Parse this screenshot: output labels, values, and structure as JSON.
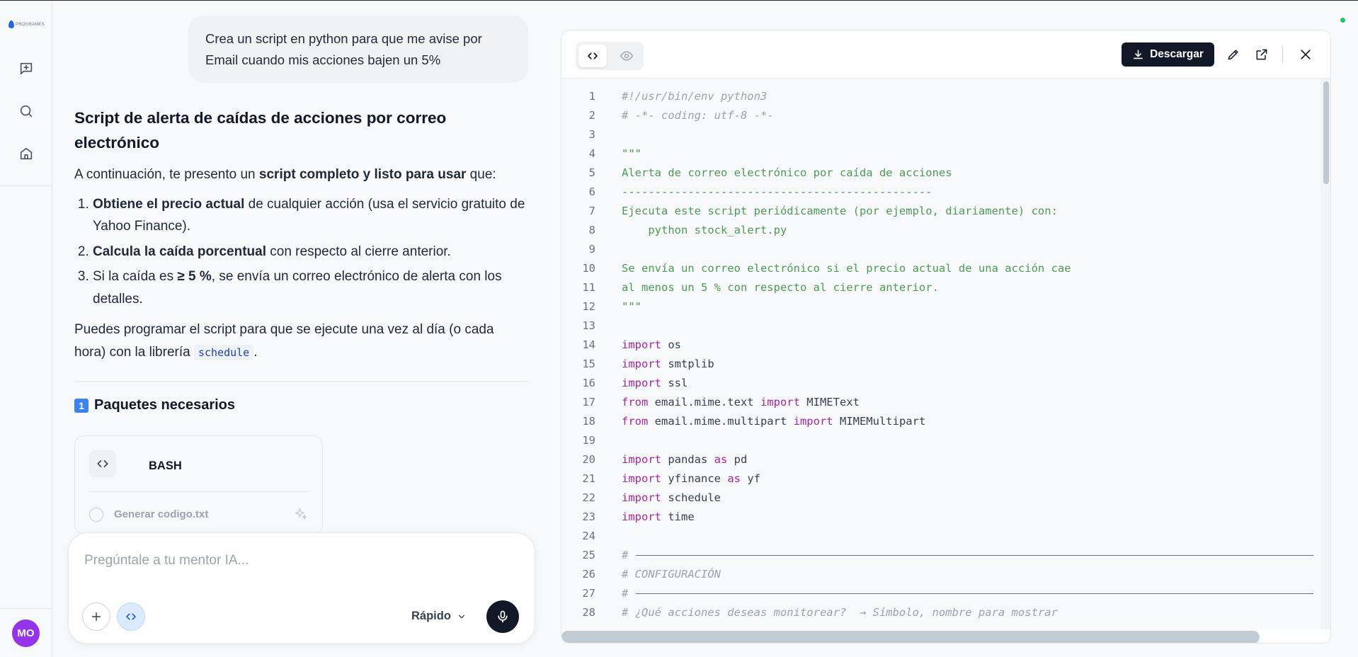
{
  "sidebar": {
    "logo_text": "PROGRAMES",
    "items": [
      {
        "name": "new-chat",
        "icon": "new-chat-icon"
      },
      {
        "name": "search",
        "icon": "search-icon"
      },
      {
        "name": "home",
        "icon": "home-icon"
      }
    ],
    "avatar": "MO"
  },
  "chat": {
    "user_message": "Crea un script en python para que me avise por Email cuando mis acciones bajen un 5%",
    "answer": {
      "title": "Script de alerta de caídas de acciones por correo electrónico",
      "intro_pre": "A continuación, te presento un ",
      "intro_bold": "script completo y listo para usar",
      "intro_post": " que:",
      "list": [
        {
          "bold": "Obtiene el precio actual",
          "text": " de cualquier acción (usa el servicio gratuito de Yahoo Finance)."
        },
        {
          "bold": "Calcula la caída porcentual",
          "text": " con respecto al cierre anterior."
        },
        {
          "pre": "Si la caída es ",
          "bold": "≥ 5 %",
          "text": ", se envía un correo electrónico de alerta con los detalles."
        }
      ],
      "p2_pre": "Puedes programar el script para que se ejecute una vez al día (o cada hora) con la librería ",
      "p2_code": "schedule",
      "p2_post": ".",
      "section_num": "1",
      "section_title": "Paquetes necesarios"
    },
    "code_card": {
      "lang": "BASH",
      "filename": "Generar codigo.txt"
    },
    "composer": {
      "placeholder": "Pregúntale a tu mentor IA...",
      "mode": "Rápido"
    }
  },
  "panel": {
    "download_label": "Descargar",
    "code_lines": [
      {
        "n": "1",
        "t": "#!/usr/bin/env python3",
        "c": "comment"
      },
      {
        "n": "2",
        "t": "# -*- coding: utf-8 -*-",
        "c": "comment"
      },
      {
        "n": "3",
        "t": "",
        "c": "plain"
      },
      {
        "n": "4",
        "t": "\"\"\"",
        "c": "doc"
      },
      {
        "n": "5",
        "t": "Alerta de correo electrónico por caída de acciones",
        "c": "doc"
      },
      {
        "n": "6",
        "t": "-----------------------------------------------",
        "c": "doc"
      },
      {
        "n": "7",
        "t": "Ejecuta este script periódicamente (por ejemplo, diariamente) con:",
        "c": "doc"
      },
      {
        "n": "8",
        "t": "    python stock_alert.py",
        "c": "doc"
      },
      {
        "n": "9",
        "t": "",
        "c": "plain"
      },
      {
        "n": "10",
        "t": "Se envía un correo electrónico si el precio actual de una acción cae",
        "c": "doc"
      },
      {
        "n": "11",
        "t": "al menos un 5 % con respecto al cierre anterior.",
        "c": "doc"
      },
      {
        "n": "12",
        "t": "\"\"\"",
        "c": "doc"
      },
      {
        "n": "13",
        "t": "",
        "c": "plain"
      },
      {
        "n": "14",
        "kw": "import",
        "t": " os",
        "c": "kw"
      },
      {
        "n": "15",
        "kw": "import",
        "t": " smtplib",
        "c": "kw"
      },
      {
        "n": "16",
        "kw": "import",
        "t": " ssl",
        "c": "kw"
      },
      {
        "n": "17",
        "kw": "from",
        "t": " email.mime.text ",
        "kw2": "import",
        "t2": " MIMEText",
        "c": "kw2"
      },
      {
        "n": "18",
        "kw": "from",
        "t": " email.mime.multipart ",
        "kw2": "import",
        "t2": " MIMEMultipart",
        "c": "kw2"
      },
      {
        "n": "19",
        "t": "",
        "c": "plain"
      },
      {
        "n": "20",
        "kw": "import",
        "t": " pandas ",
        "kw2": "as",
        "t2": " pd",
        "c": "kw2"
      },
      {
        "n": "21",
        "kw": "import",
        "t": " yfinance ",
        "kw2": "as",
        "t2": " yf",
        "c": "kw2"
      },
      {
        "n": "22",
        "kw": "import",
        "t": " schedule",
        "c": "kw"
      },
      {
        "n": "23",
        "kw": "import",
        "t": " time",
        "c": "kw"
      },
      {
        "n": "24",
        "t": "",
        "c": "plain"
      },
      {
        "n": "25",
        "t": "#",
        "c": "rule"
      },
      {
        "n": "26",
        "t": "# CONFIGURACIÓN",
        "c": "comment"
      },
      {
        "n": "27",
        "t": "#",
        "c": "rule"
      },
      {
        "n": "28",
        "t": "# ¿Qué acciones deseas monitorear?  → Símbolo, nombre para mostrar",
        "c": "comment"
      }
    ]
  },
  "colors": {
    "accent": "#111827",
    "avatar": "#9333ea",
    "keyword": "#a626a4",
    "docstring": "#4d9b55",
    "status": "#22c55e"
  }
}
